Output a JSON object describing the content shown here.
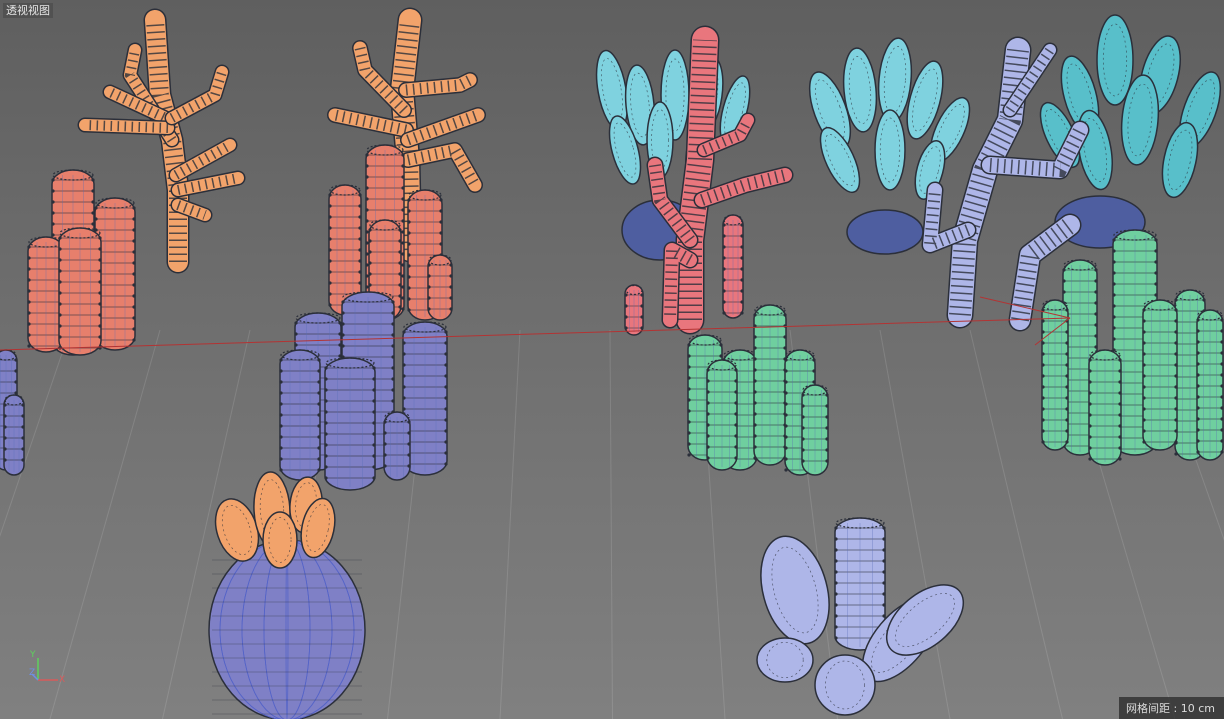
{
  "viewport": {
    "view_name": "透视视图",
    "grid_spacing": "网格间距 : 10 cm"
  },
  "axes": {
    "x": "X",
    "y": "Y",
    "z": "Z"
  },
  "colors": {
    "background_top": "#5f5f5f",
    "background_bottom": "#808080",
    "coral_orange": "#f2a36b",
    "coral_salmon": "#e77f6c",
    "coral_purple": "#7f80c6",
    "coral_pink": "#e9767d",
    "coral_cyan": "#7fd2df",
    "coral_teal": "#58bfca",
    "coral_lavender": "#aeb6e8",
    "coral_green": "#6fcf9f",
    "wire_edge": "#2b2f3a",
    "selection_line": "#b33333"
  },
  "objects": [
    "branch-coral-orange-left",
    "tube-coral-salmon-left",
    "branch-coral-orange-center",
    "tube-coral-salmon-center",
    "tube-coral-purple-center",
    "sea-anemone-purple",
    "branch-coral-pink",
    "fan-coral-cyan",
    "branch-coral-lavender",
    "fan-coral-teal",
    "tube-coral-green-center",
    "tube-coral-green-right",
    "finger-coral-lavender-bottom",
    "tube-coral-purple-left-edge"
  ]
}
